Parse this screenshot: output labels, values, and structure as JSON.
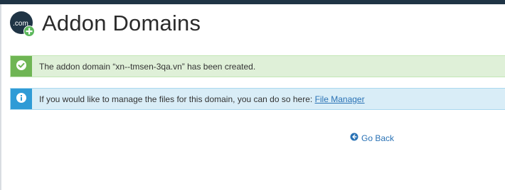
{
  "page": {
    "title": "Addon Domains",
    "logo_text": ".com"
  },
  "alerts": {
    "success_message": "The addon domain “xn--tmsen-3qa.vn” has been created.",
    "info_message": "If you would like to manage the files for this domain, you can do so here: ",
    "info_link": "File Manager"
  },
  "nav": {
    "go_back_label": "Go Back"
  },
  "icons": {
    "logo": "addon-domain-icon",
    "success": "check-circle-icon",
    "info": "info-circle-icon",
    "go_back": "arrow-circle-left-icon"
  },
  "colors": {
    "success_accent": "#6fb554",
    "success_bg": "#dff0d8",
    "info_accent": "#2f9bd6",
    "info_bg": "#d9edf7",
    "link": "#2a72b5",
    "topbar": "#1f3445"
  }
}
